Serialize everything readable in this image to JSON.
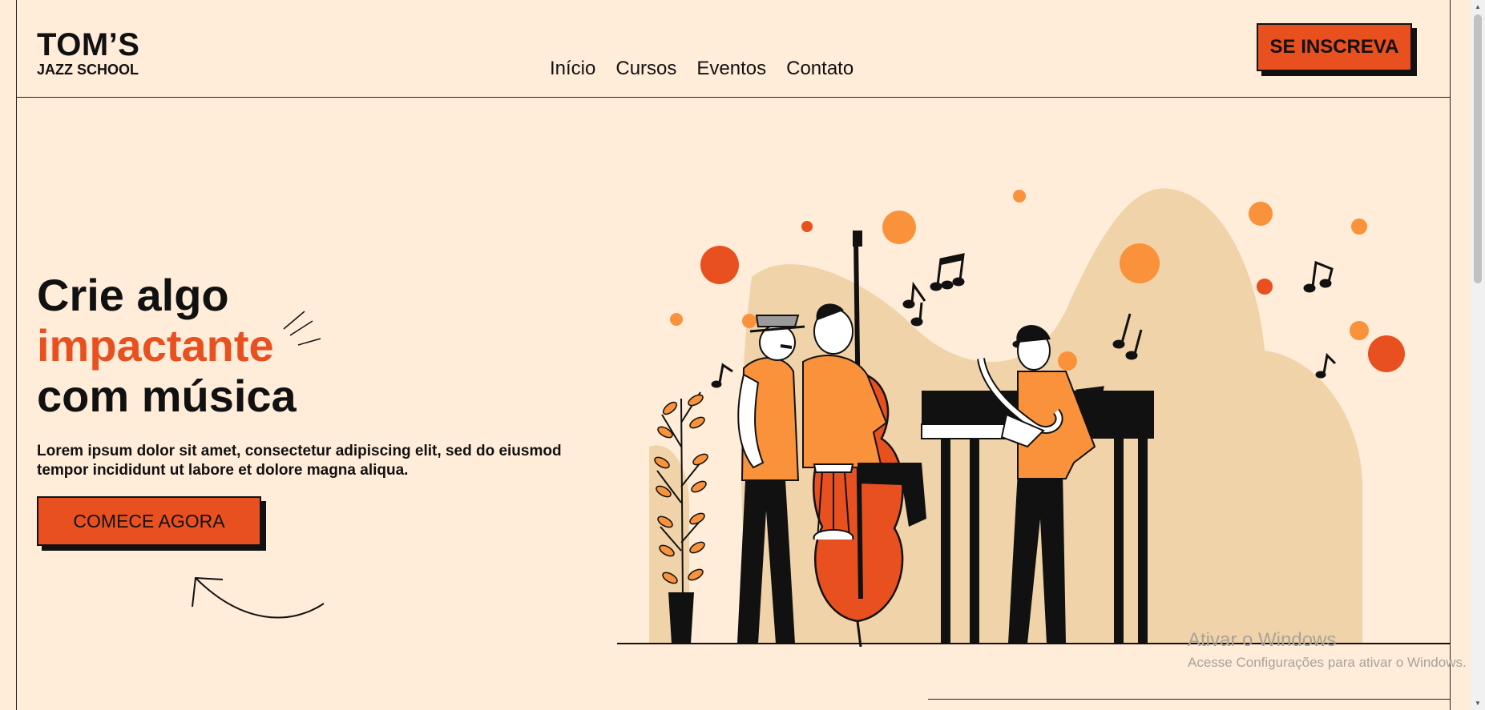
{
  "header": {
    "logo_line1": "TOM’S",
    "logo_line2": "JAZZ SCHOOL",
    "nav": [
      "Início",
      "Cursos",
      "Eventos",
      "Contato"
    ],
    "cta": "SE INSCREVA"
  },
  "hero": {
    "line1": "Crie algo",
    "line2": "impactante",
    "line3": "com música",
    "text_line1": "Lorem ipsum dolor sit amet, consectetur adipiscing elit, sed do eiusmod",
    "text_line2": "tempor incididunt ut labore et dolore magna aliqua.",
    "cta": "COMECE AGORA"
  },
  "watermark": {
    "line1": "Ativar o Windows",
    "line2": "Acesse Configurações para ativar o Windows."
  },
  "colors": {
    "background": "#ffecd9",
    "accent": "#e8501f",
    "orange": "#f9923a",
    "sand": "#f0d3a9",
    "ink": "#111111"
  },
  "icons": {
    "spark": "spark-lines-icon",
    "arrow": "curved-arrow-icon",
    "illustration": "jazz-band-illustration"
  }
}
